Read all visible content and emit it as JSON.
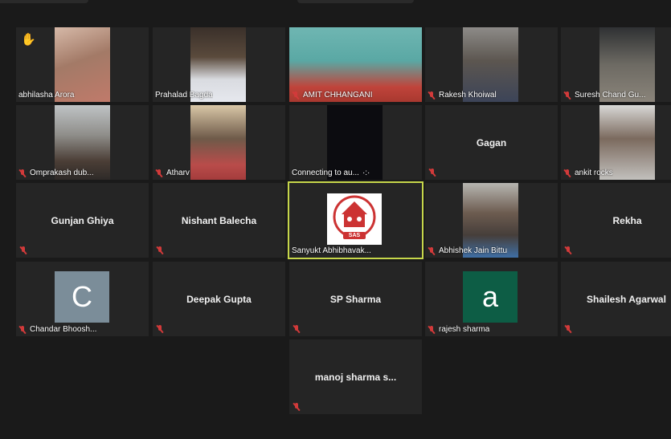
{
  "colors": {
    "background": "#1a1a1a",
    "tile": "#252525",
    "active_border": "#c6d64a",
    "muted": "#d23a3a"
  },
  "participants": {
    "abhilasha": {
      "name": "abhilasha Arora",
      "reaction": "✋"
    },
    "prahalad": {
      "name": "Prahalad Bagda"
    },
    "amit": {
      "name": "AMIT CHHANGANI"
    },
    "rakesh": {
      "name": "Rakesh Khoiwal"
    },
    "suresh": {
      "name": "Suresh Chand Gu..."
    },
    "omprakash": {
      "name": "Omprakash dub..."
    },
    "atharv": {
      "name": "Atharv"
    },
    "connecting": {
      "name": "Connecting to au..."
    },
    "gagan": {
      "name": "Gagan"
    },
    "ankit": {
      "name": "ankit rocks"
    },
    "gunjan": {
      "name": "Gunjan Ghiya"
    },
    "nishant": {
      "name": "Nishant Balecha"
    },
    "sanyukt": {
      "name": "Sanyukt Abhibhavak...",
      "logo_text": "SAS"
    },
    "abhishek": {
      "name": "Abhishek Jain Bittu"
    },
    "rekha": {
      "name": "Rekha"
    },
    "chandar": {
      "name": "Chandar Bhoosh...",
      "avatar_letter": "C"
    },
    "deepak": {
      "name": "Deepak Gupta"
    },
    "sp": {
      "name": "SP Sharma"
    },
    "rajesh": {
      "name": "rajesh sharma",
      "avatar_letter": "a"
    },
    "shailesh": {
      "name": "Shailesh Agarwal"
    },
    "manoj": {
      "name": "manoj sharma s..."
    }
  }
}
